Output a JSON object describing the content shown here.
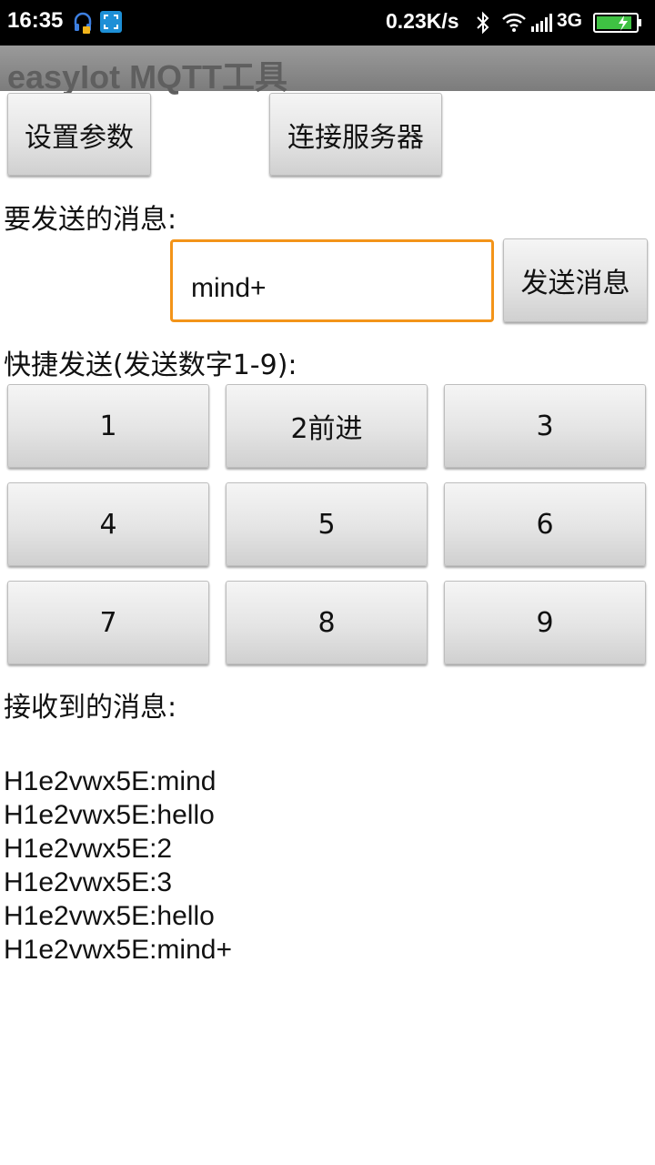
{
  "status_bar": {
    "time": "16:35",
    "net_speed": "0.23K/s",
    "network_type": "3G",
    "icons": [
      "headset-icon",
      "screenshot-icon",
      "bluetooth-icon",
      "wifi-icon",
      "signal-icon",
      "battery-charging-icon"
    ]
  },
  "app": {
    "title": "easyIot MQTT工具"
  },
  "toolbar": {
    "settings_label": "设置参数",
    "connect_label": "连接服务器"
  },
  "send": {
    "label": "要发送的消息:",
    "input_value": "mind+",
    "send_label": "发送消息"
  },
  "quick": {
    "label": "快捷发送(发送数字1-9):",
    "buttons": [
      "1",
      "2前进",
      "3",
      "4",
      "5",
      "6",
      "7",
      "8",
      "9"
    ]
  },
  "receive": {
    "label": "接收到的消息:",
    "messages": [
      "H1e2vwx5E:mind",
      "H1e2vwx5E:hello",
      "H1e2vwx5E:2",
      "H1e2vwx5E:3",
      "H1e2vwx5E:hello",
      "H1e2vwx5E:mind+"
    ]
  },
  "colors": {
    "accent": "#f39419",
    "title_bar": "#8a8a8a",
    "battery": "#3fc143"
  }
}
